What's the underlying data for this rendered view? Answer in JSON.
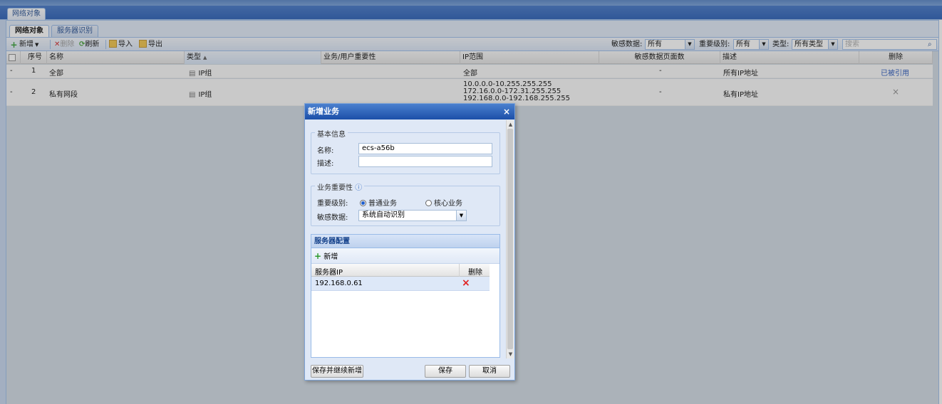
{
  "outer_tab": "网络对象",
  "inner_tabs": [
    "网络对象",
    "服务器识别"
  ],
  "toolbar": {
    "add": "新增",
    "delete": "删除",
    "refresh": "刷新",
    "import": "导入",
    "export": "导出",
    "sensitive_label": "敏感数据:",
    "sensitive_value": "所有",
    "level_label": "重要级别:",
    "level_value": "所有",
    "type_label": "类型:",
    "type_value": "所有类型",
    "search_placeholder": "搜索"
  },
  "grid": {
    "headers": [
      "序号",
      "名称",
      "类型",
      "业务/用户重要性",
      "IP范围",
      "敏感数据页面数",
      "描述",
      "删除"
    ],
    "rows": [
      {
        "expander": "-",
        "index": "1",
        "name": "全部",
        "type": "IP组",
        "importance": "",
        "ip_range": [
          "全部"
        ],
        "sensitive_pages": "-",
        "desc": "所有IP地址",
        "delete": "已被引用"
      },
      {
        "expander": "-",
        "index": "2",
        "name": "私有网段",
        "type": "IP组",
        "importance": "",
        "ip_range": [
          "10.0.0.0-10.255.255.255",
          "172.16.0.0-172.31.255.255",
          "192.168.0.0-192.168.255.255"
        ],
        "sensitive_pages": "-",
        "desc": "私有IP地址",
        "delete": "×"
      }
    ]
  },
  "dialog": {
    "title": "新增业务",
    "close": "×",
    "basic": {
      "legend": "基本信息",
      "name_label": "名称:",
      "name_value": "ecs-a56b",
      "desc_label": "描述:",
      "desc_value": ""
    },
    "importance": {
      "legend": "业务重要性",
      "info_icon": "ⓘ",
      "level_label": "重要级别:",
      "option_normal": "普通业务",
      "option_core": "核心业务",
      "selected": "普通业务",
      "sensitive_label": "敏感数据:",
      "sensitive_value": "系统自动识别"
    },
    "servers": {
      "title": "服务器配置",
      "add": "新增",
      "col_ip": "服务器IP",
      "col_delete": "删除",
      "rows": [
        {
          "ip": "192.168.0.61",
          "delete": "×"
        }
      ]
    },
    "buttons": {
      "save_continue": "保存并继续新增",
      "save": "保存",
      "cancel": "取消"
    }
  },
  "colors": {
    "accent": "#1c4fa8",
    "panel": "#dfe8f6",
    "delete_red": "#e02020"
  }
}
